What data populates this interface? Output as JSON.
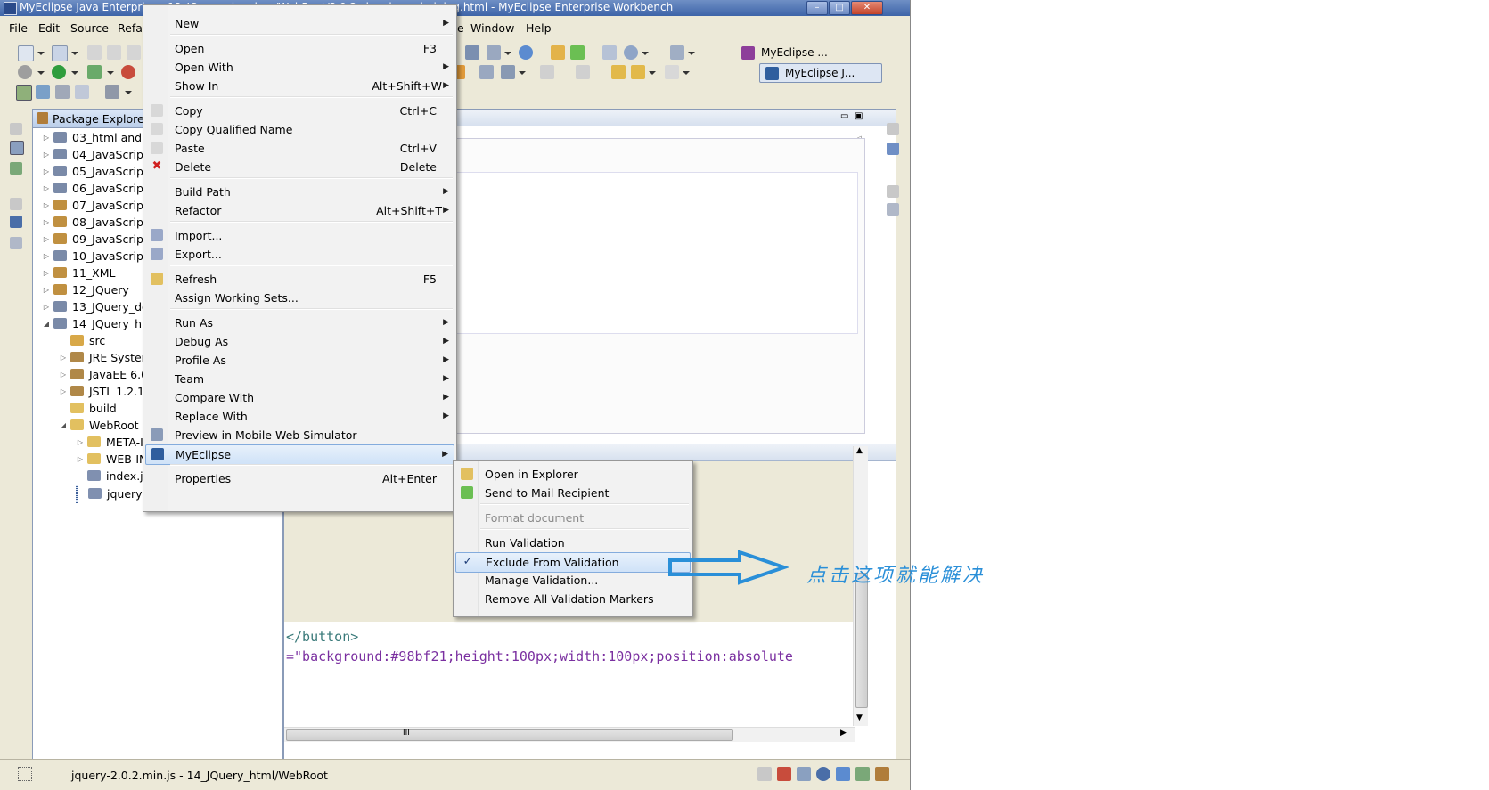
{
  "window": {
    "title": "MyEclipse Java Enterprise - 13_JQuery_donghua/WebRoot/3.9.2_donghua_chaining.html - MyEclipse Enterprise Workbench",
    "minimize_label": "–",
    "maximize_label": "□",
    "close_label": "✕"
  },
  "menubar": {
    "items": [
      "File",
      "Edit",
      "Source",
      "Refa",
      "e",
      "Window",
      "Help"
    ]
  },
  "perspectives": {
    "first": "MyEclipse ...",
    "second": "MyEclipse J..."
  },
  "package_explorer": {
    "title": "Package Explorer",
    "items": [
      {
        "label": "03_html and c",
        "twisty": "▷"
      },
      {
        "label": "04_JavaScript",
        "twisty": "▷"
      },
      {
        "label": "05_JavaScript",
        "twisty": "▷"
      },
      {
        "label": "06_JavaScript",
        "twisty": "▷"
      },
      {
        "label": "07_JavaScript",
        "twisty": "▷"
      },
      {
        "label": "08_JavaScript",
        "twisty": "▷"
      },
      {
        "label": "09_JavaScript",
        "twisty": "▷"
      },
      {
        "label": "10_JavaScript",
        "twisty": "▷"
      },
      {
        "label": "11_XML",
        "twisty": "▷"
      },
      {
        "label": "12_JQuery",
        "twisty": "▷"
      },
      {
        "label": "13_JQuery_do",
        "twisty": "▷"
      },
      {
        "label": "14_JQuery_htr",
        "twisty": "◢"
      },
      {
        "label": "src",
        "twisty": ""
      },
      {
        "label": "JRE System",
        "twisty": "▷"
      },
      {
        "label": "JavaEE 6.0",
        "twisty": "▷"
      },
      {
        "label": "JSTL 1.2.1",
        "twisty": "▷"
      },
      {
        "label": "build",
        "twisty": ""
      },
      {
        "label": "WebRoot",
        "twisty": "◢"
      },
      {
        "label": "META-I",
        "twisty": "▷"
      },
      {
        "label": "WEB-IN",
        "twisty": "▷"
      },
      {
        "label": "index.js",
        "twisty": ""
      },
      {
        "label": "jquery-2.0.2.min.js",
        "twisty": ""
      }
    ]
  },
  "context_menu": {
    "items": [
      {
        "label": "New",
        "shortcut": "",
        "submenu": true
      },
      {
        "label": "Open",
        "shortcut": "F3",
        "submenu": false
      },
      {
        "label": "Open With",
        "shortcut": "",
        "submenu": true
      },
      {
        "label": "Show In",
        "shortcut": "Alt+Shift+W",
        "submenu": true
      },
      {
        "label": "Copy",
        "shortcut": "Ctrl+C",
        "submenu": false
      },
      {
        "label": "Copy Qualified Name",
        "shortcut": "",
        "submenu": false
      },
      {
        "label": "Paste",
        "shortcut": "Ctrl+V",
        "submenu": false
      },
      {
        "label": "Delete",
        "shortcut": "Delete",
        "submenu": false
      },
      {
        "label": "Build Path",
        "shortcut": "",
        "submenu": true
      },
      {
        "label": "Refactor",
        "shortcut": "Alt+Shift+T",
        "submenu": true
      },
      {
        "label": "Import...",
        "shortcut": "",
        "submenu": false
      },
      {
        "label": "Export...",
        "shortcut": "",
        "submenu": false
      },
      {
        "label": "Refresh",
        "shortcut": "F5",
        "submenu": false
      },
      {
        "label": "Assign Working Sets...",
        "shortcut": "",
        "submenu": false
      },
      {
        "label": "Run As",
        "shortcut": "",
        "submenu": true
      },
      {
        "label": "Debug As",
        "shortcut": "",
        "submenu": true
      },
      {
        "label": "Profile As",
        "shortcut": "",
        "submenu": true
      },
      {
        "label": "Team",
        "shortcut": "",
        "submenu": true
      },
      {
        "label": "Compare With",
        "shortcut": "",
        "submenu": true
      },
      {
        "label": "Replace With",
        "shortcut": "",
        "submenu": true
      },
      {
        "label": "Preview in Mobile Web Simulator",
        "shortcut": "",
        "submenu": false
      },
      {
        "label": "MyEclipse",
        "shortcut": "",
        "submenu": true
      },
      {
        "label": "Properties",
        "shortcut": "Alt+Enter",
        "submenu": false
      }
    ]
  },
  "submenu": {
    "items": [
      {
        "label": "Open in Explorer",
        "checked": false,
        "disabled": false
      },
      {
        "label": "Send to Mail Recipient",
        "checked": false,
        "disabled": false
      },
      {
        "label": "Format document",
        "checked": false,
        "disabled": true
      },
      {
        "label": "Run Validation",
        "checked": false,
        "disabled": false
      },
      {
        "label": "Exclude From Validation",
        "checked": true,
        "disabled": false
      },
      {
        "label": "Manage Validation...",
        "checked": false,
        "disabled": false
      },
      {
        "label": "Remove All Validation Markers",
        "checked": false,
        "disabled": false
      }
    ],
    "check_mark": "✓"
  },
  "editor": {
    "code_lines": [
      "</button>",
      "=\"background:#98bf21;height:100px;width:100px;position:absolute"
    ],
    "hscroll_label": "III"
  },
  "status_bar": {
    "text": "jquery-2.0.2.min.js - 14_JQuery_html/WebRoot"
  },
  "annotation": {
    "text": "点击这项就能解决",
    "color": "#2a8fd8"
  },
  "colors": {
    "highlight": "#cfe2f8",
    "title_bar": "#3d64a8"
  }
}
